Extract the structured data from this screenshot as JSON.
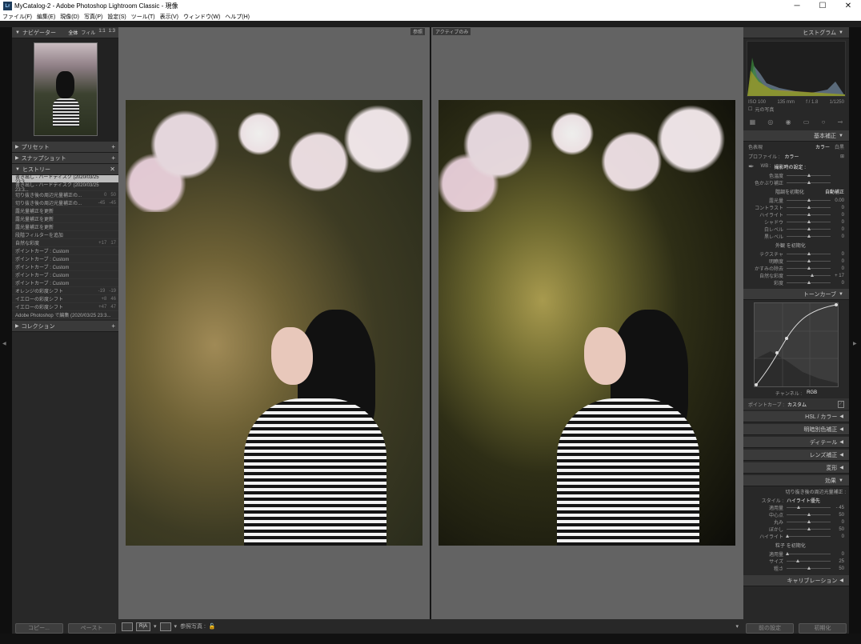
{
  "window": {
    "title": "MyCatalog-2 - Adobe Photoshop Lightroom Classic - 現像",
    "lr_logo": "Lr",
    "min": "─",
    "max": "☐",
    "close": "✕"
  },
  "menu": [
    "ファイル(F)",
    "編集(E)",
    "現像(D)",
    "写真(P)",
    "設定(S)",
    "ツール(T)",
    "表示(V)",
    "ウィンドウ(W)",
    "ヘルプ(H)"
  ],
  "left": {
    "navigator": {
      "title": "ナビゲーター",
      "zoom": [
        "全体",
        "フィル",
        "1:1",
        "1:3"
      ]
    },
    "preset_title": "プリセット",
    "snapshot_title": "スナップショット",
    "history_title": "ヒストリー",
    "history": [
      {
        "label": "書き出し - ハードディスク (2020/03/25 23:3...",
        "a": "",
        "b": "",
        "sel": true
      },
      {
        "label": "書き出し - ハードディスク (2020/03/25 23:3...",
        "a": "",
        "b": ""
      },
      {
        "label": "切り抜き後の周辺光量補正の...",
        "a": "0",
        "b": "50"
      },
      {
        "label": "切り抜き後の周辺光量補正の...",
        "a": "-45",
        "b": "-45"
      },
      {
        "label": "露光量補正を更新",
        "a": "",
        "b": ""
      },
      {
        "label": "露光量補正を更新",
        "a": "",
        "b": ""
      },
      {
        "label": "露光量補正を更新",
        "a": "",
        "b": ""
      },
      {
        "label": "段階フィルターを追加",
        "a": "",
        "b": ""
      },
      {
        "label": "自然な彩度",
        "a": "+17",
        "b": "17"
      },
      {
        "label": "ポイントカーブ : Custom",
        "a": "",
        "b": ""
      },
      {
        "label": "ポイントカーブ : Custom",
        "a": "",
        "b": ""
      },
      {
        "label": "ポイントカーブ : Custom",
        "a": "",
        "b": ""
      },
      {
        "label": "ポイントカーブ : Custom",
        "a": "",
        "b": ""
      },
      {
        "label": "ポイントカーブ : Custom",
        "a": "",
        "b": ""
      },
      {
        "label": "オレンジの彩度シフト",
        "a": "-19",
        "b": "-19"
      },
      {
        "label": "イエローの彩度シフト",
        "a": "+8",
        "b": "46"
      },
      {
        "label": "イエローの彩度シフト",
        "a": "+47",
        "b": "47"
      },
      {
        "label": "Adobe Photoshop で編集 (2020/03/25 23:3...",
        "a": "",
        "b": ""
      }
    ],
    "collection_title": "コレクション",
    "copy": "コピー...",
    "paste": "ペースト"
  },
  "center": {
    "before_label": "参照",
    "after_label": "アクティブのみ",
    "toolbar_label": "参照写真 :",
    "ba_label": "R|A"
  },
  "right": {
    "histogram_title": "ヒストグラム",
    "exif": [
      "ISO 100",
      "135 mm",
      "f / 1.8",
      "1/1250"
    ],
    "original_photo": "元の写真",
    "basic_title": "基本補正",
    "treatment": "色表現",
    "treatment_color": "カラー",
    "treatment_bw": "白黒",
    "profile_label": "プロファイル :",
    "profile_value": "カラー",
    "wb_label": "WB :",
    "wb_value": "撮影時の設定 :",
    "rows_wb": [
      {
        "label": "色温度",
        "val": "",
        "pos": 50
      },
      {
        "label": "色かぶり補正",
        "val": "",
        "pos": 50
      }
    ],
    "tone_label": "階調",
    "tone_auto": "自動補正",
    "tone_reset": "を初期化",
    "rows_tone": [
      {
        "label": "露光量",
        "val": "0.00",
        "pos": 50
      },
      {
        "label": "コントラスト",
        "val": "0",
        "pos": 50
      },
      {
        "label": "ハイライト",
        "val": "0",
        "pos": 50
      },
      {
        "label": "シャドウ",
        "val": "0",
        "pos": 50
      },
      {
        "label": "白レベル",
        "val": "0",
        "pos": 50
      },
      {
        "label": "黒レベル",
        "val": "0",
        "pos": 50
      }
    ],
    "presence_label": "外観",
    "presence_reset": "を初期化",
    "rows_presence": [
      {
        "label": "テクスチャ",
        "val": "0",
        "pos": 50
      },
      {
        "label": "明瞭度",
        "val": "0",
        "pos": 50
      },
      {
        "label": "かすみの除去",
        "val": "0",
        "pos": 50
      },
      {
        "label": "自然な彩度",
        "val": "+ 17",
        "pos": 59
      },
      {
        "label": "彩度",
        "val": "0",
        "pos": 50
      }
    ],
    "tonecurve_title": "トーンカーブ",
    "channel_label": "チャンネル :",
    "channel_value": "RGB",
    "pointcurve_label": "ポイントカーブ :",
    "pointcurve_value": "カスタム",
    "hsl_title": "HSL / カラー",
    "split_title": "明暗別色補正",
    "detail_title": "ディテール",
    "lens_title": "レンズ補正",
    "transform_title": "変形",
    "effects_title": "効果",
    "vignette_label": "切り抜き後の周辺光量補正 :",
    "style_label": "スタイル :",
    "style_value": "ハイライト優先",
    "rows_vignette": [
      {
        "label": "適用量",
        "val": "- 45",
        "pos": 28
      },
      {
        "label": "中心点",
        "val": "50",
        "pos": 50
      },
      {
        "label": "丸み",
        "val": "0",
        "pos": 50
      },
      {
        "label": "ぼかし",
        "val": "50",
        "pos": 50
      },
      {
        "label": "ハイライト",
        "val": "0",
        "pos": 2
      }
    ],
    "grain_label": "粒子",
    "grain_reset": "を初期化",
    "rows_grain": [
      {
        "label": "適用量",
        "val": "0",
        "pos": 2
      },
      {
        "label": "サイズ",
        "val": "25",
        "pos": 25
      },
      {
        "label": "粗さ",
        "val": "50",
        "pos": 50
      }
    ],
    "calibration_title": "キャリブレーション",
    "prev_button": "前の設定",
    "reset_button": "初期化"
  }
}
